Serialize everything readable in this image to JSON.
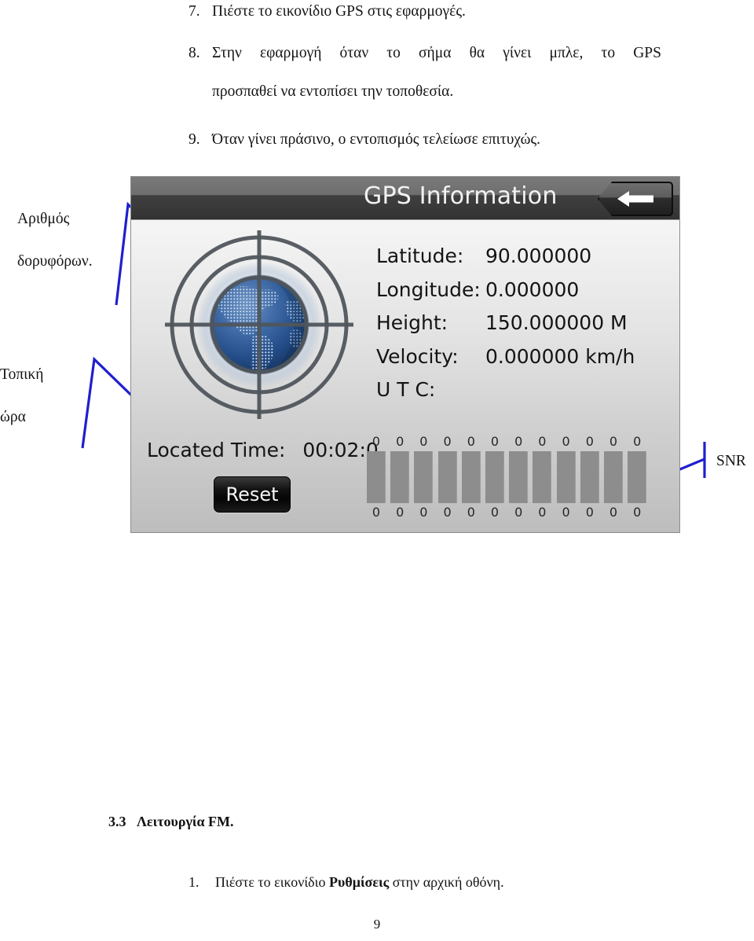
{
  "document": {
    "steps": [
      {
        "number": "7.",
        "text": "Πιέστε το εικονίδιο GPS στις εφαρμογές."
      },
      {
        "number": "8.",
        "line1": "Στην εφαρμογή όταν το σήμα θα γίνει μπλε, το GPS",
        "line2": "προσπαθεί να εντοπίσει την τοποθεσία."
      },
      {
        "number": "9.",
        "text": "Όταν γίνει πράσινο, ο εντοπισμός τελείωσε επιτυχώς."
      }
    ],
    "section": {
      "number": "3.3",
      "title": "Λειτουργία FM."
    },
    "final_step": {
      "number": "1.",
      "prefix": "Πιέστε το εικονίδιο ",
      "bold": "Ρυθμίσεις",
      "suffix": " στην αρχική οθόνη."
    },
    "page_number": "9"
  },
  "annotations": {
    "satellites_line1": "Αριθμός",
    "satellites_line2": "δορυφόρων.",
    "localtime_line1": "Τοπική",
    "localtime_line2": "ώρα",
    "snr": "SNR",
    "line_color": "#1f1fcf"
  },
  "gps_app": {
    "title": "GPS Information",
    "back_icon": "arrow-left-icon",
    "globe_icon": "globe-radar-crosshair-icon",
    "readout": [
      {
        "label": "Latitude:",
        "value": "90.000000"
      },
      {
        "label": "Longitude:",
        "value": "0.000000"
      },
      {
        "label": "Height:",
        "value": "150.000000 M"
      },
      {
        "label": "Velocity:",
        "value": "0.000000 km/h"
      },
      {
        "label": "U T C:",
        "value": ""
      }
    ],
    "located_time": {
      "label": "Located Time:",
      "value": "00:02:0"
    },
    "reset_label": "Reset",
    "snr_chart": {
      "top_values": [
        "0",
        "0",
        "0",
        "0",
        "0",
        "0",
        "0",
        "0",
        "0",
        "0",
        "0",
        "0"
      ],
      "bottom_values": [
        "0",
        "0",
        "0",
        "0",
        "0",
        "0",
        "0",
        "0",
        "0",
        "0",
        "0",
        "0"
      ],
      "bar_color": "#8d8d8d",
      "bar_count": 12
    },
    "colors": {
      "titlebar_dark": "#343434",
      "titlebar_light": "#6e6e6e",
      "panel_bg": "#dcdcdc",
      "globe_blue": "#1f4d8c"
    }
  }
}
